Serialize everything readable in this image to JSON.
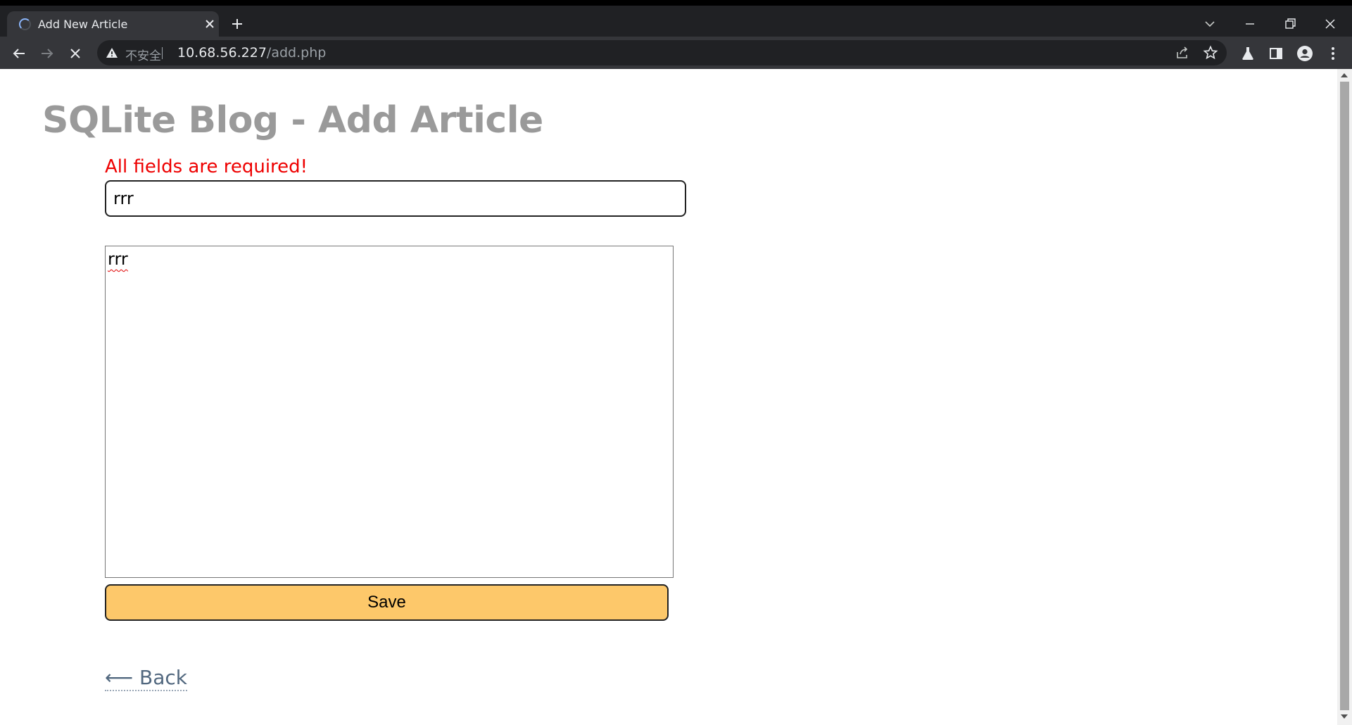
{
  "browser": {
    "tab_title": "Add New Article",
    "insecure_label": "不安全",
    "url_host": "10.68.56.227",
    "url_path": "/add.php"
  },
  "page": {
    "title": "SQLite Blog - Add Article",
    "error_message": "All fields are required!",
    "title_field_value": "rrr",
    "body_field_value": "rrr",
    "save_label": "Save",
    "back_label": "⟵ Back"
  },
  "colors": {
    "error": "#ee0000",
    "save_button": "#fdc86a",
    "page_title": "#9a9a9a",
    "back_link": "#52687f"
  }
}
